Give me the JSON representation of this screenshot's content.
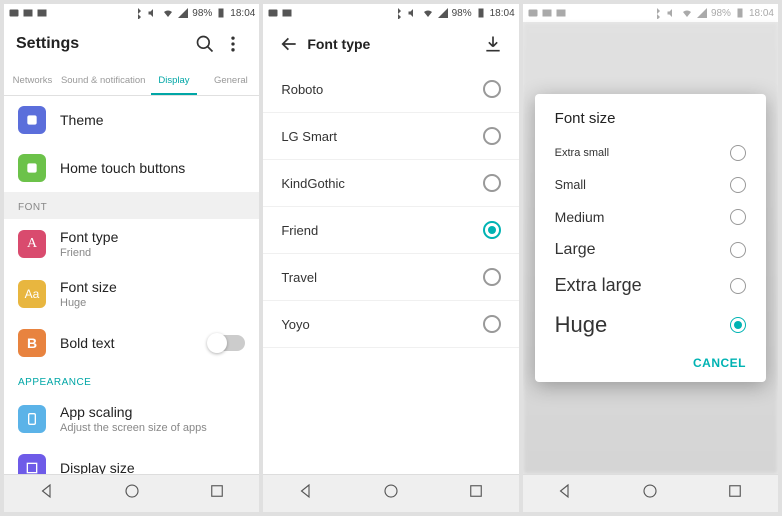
{
  "statusbar": {
    "signal": "98%",
    "time": "18:04"
  },
  "screen1": {
    "title": "Settings",
    "tabs": [
      "Networks",
      "Sound & notification",
      "Display",
      "General"
    ],
    "active_tab": 2,
    "items": {
      "theme": {
        "label": "Theme",
        "icon_color": "#5b6edb"
      },
      "home_touch": {
        "label": "Home touch buttons",
        "icon_color": "#4caf50"
      },
      "font_section": "FONT",
      "font_type": {
        "label": "Font type",
        "sublabel": "Friend",
        "icon_color": "#d94b6e",
        "icon_letter": "A"
      },
      "font_size": {
        "label": "Font size",
        "sublabel": "Huge",
        "icon_color": "#e8b63f",
        "icon_letter": "Aa"
      },
      "bold_text": {
        "label": "Bold text",
        "icon_color": "#e8833f",
        "icon_letter": "B",
        "value": false
      },
      "appearance_section": "APPEARANCE",
      "app_scaling": {
        "label": "App scaling",
        "sublabel": "Adjust the screen size of apps",
        "icon_color": "#3fa8e8"
      },
      "display_size": {
        "label": "Display size",
        "icon_color": "#6e5be8"
      }
    }
  },
  "screen2": {
    "title": "Font type",
    "fonts": [
      {
        "name": "Roboto",
        "selected": false
      },
      {
        "name": "LG Smart",
        "selected": false
      },
      {
        "name": "KindGothic",
        "selected": false
      },
      {
        "name": "Friend",
        "selected": true
      },
      {
        "name": "Travel",
        "selected": false
      },
      {
        "name": "Yoyo",
        "selected": false
      }
    ]
  },
  "screen3": {
    "dialog_title": "Font size",
    "options": [
      {
        "label": "Extra small",
        "cls": "sz-xs",
        "selected": false
      },
      {
        "label": "Small",
        "cls": "sz-sm",
        "selected": false
      },
      {
        "label": "Medium",
        "cls": "sz-md",
        "selected": false
      },
      {
        "label": "Large",
        "cls": "sz-lg",
        "selected": false
      },
      {
        "label": "Extra large",
        "cls": "sz-xl",
        "selected": false
      },
      {
        "label": "Huge",
        "cls": "sz-huge",
        "selected": true
      }
    ],
    "cancel": "CANCEL"
  }
}
